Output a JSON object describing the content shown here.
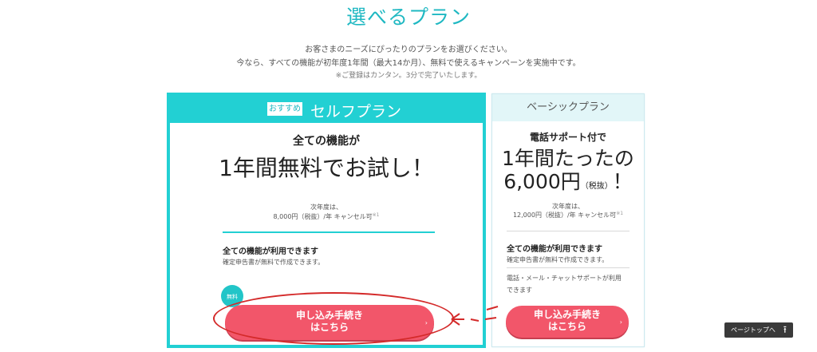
{
  "page": {
    "title": "選べるプラン",
    "intro_line1": "お客さまのニーズにぴったりのプランをお選びください。",
    "intro_line2": "今なら、すべての機能が初年度1年間（最大14か月）、無料で使えるキャンペーンを実施中です。",
    "intro_note": "※ご登録はカンタン。3分で完了いたします。"
  },
  "self_plan": {
    "badge": "おすすめ",
    "name": "セルフプラン",
    "lead": "全ての機能が",
    "headline": "1年間無料でお試し！",
    "next_year_label": "次年度は、",
    "next_year_price": "8,000円（税抜）/年 キャンセル可",
    "note_mark": "※1",
    "feature_title": "全ての機能が利用できます",
    "feature_desc": "確定申告書が無料で作成できます。",
    "free_badge": "無料",
    "button_line1": "申し込み手続き",
    "button_line2": "はこちら",
    "button_arrow": "›"
  },
  "basic_plan": {
    "name": "ベーシックプラン",
    "lead": "電話サポート付で",
    "headline_line1": "1年間たったの",
    "headline_price": "6,000円",
    "headline_tax": "（税抜）",
    "headline_end": "！",
    "next_year_label": "次年度は、",
    "next_year_price": "12,000円（税抜）/年 キャンセル可",
    "note_mark": "※1",
    "feature_title": "全ての機能が利用できます",
    "feature_desc": "確定申告書が無料で作成できます。",
    "support_desc": "電話・メール・チャットサポートが利用できます",
    "button_line1": "申し込み手続き",
    "button_line2": "はこちら",
    "button_arrow": "›"
  },
  "page_top": {
    "label": "ページトップへ",
    "icon": "arrow-up-icon"
  },
  "colors": {
    "accent_teal": "#22d0d3",
    "button_pink": "#f2566a",
    "annotation_red": "#d42a2a"
  }
}
